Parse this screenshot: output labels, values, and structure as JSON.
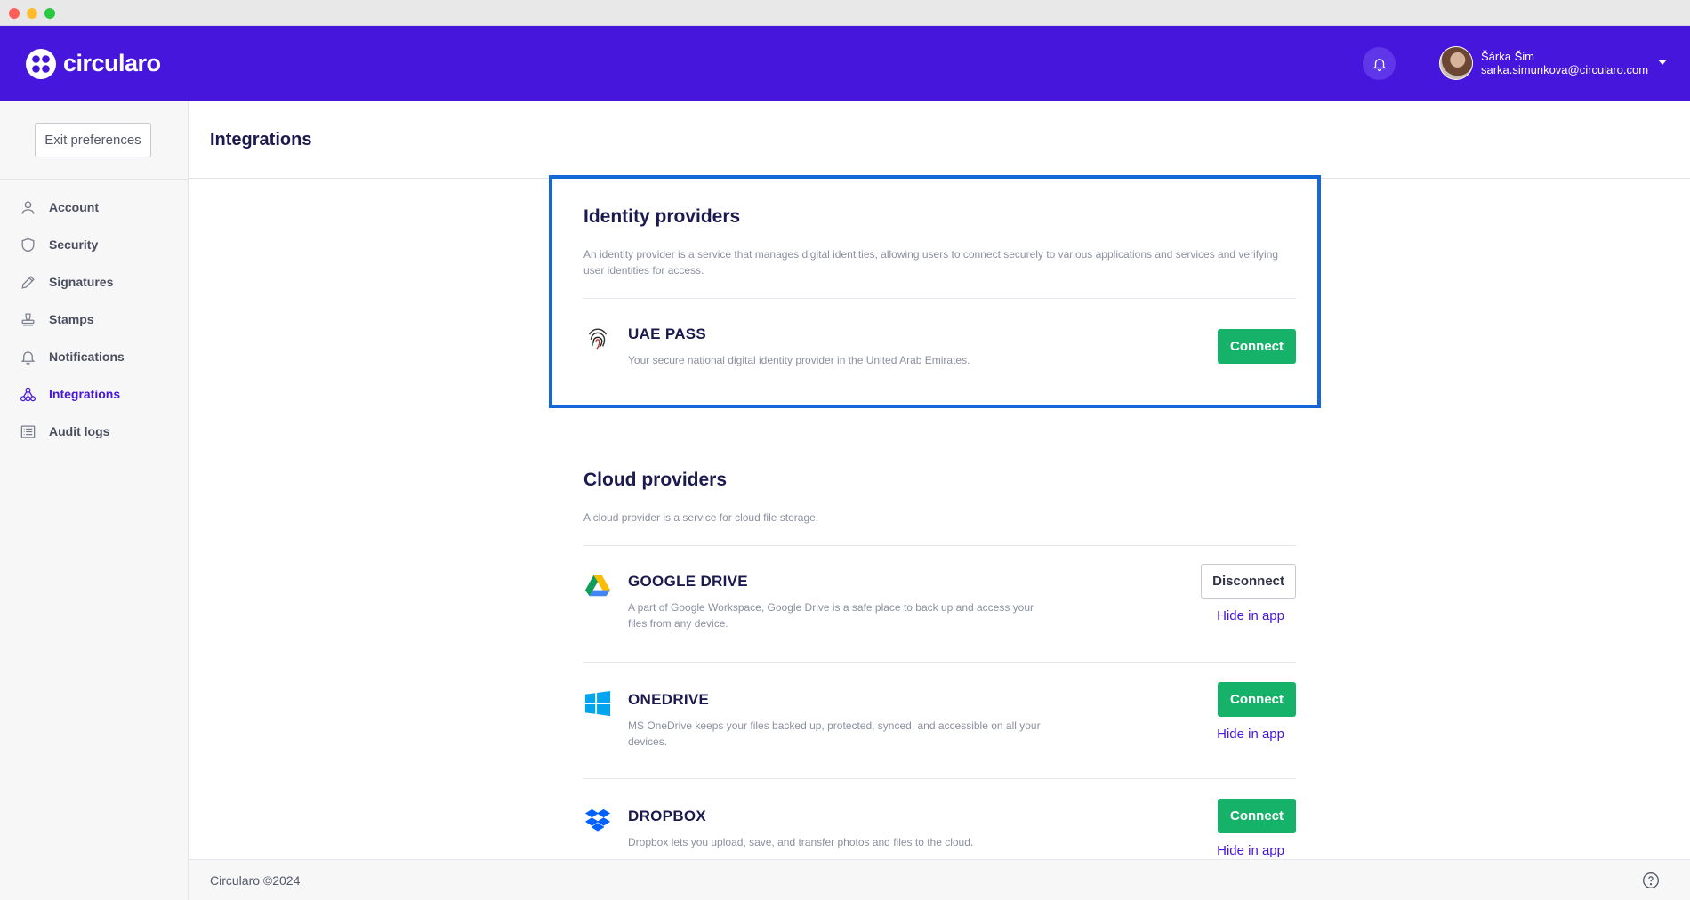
{
  "app": {
    "brand": "circularo",
    "brand_color": "#4716dc",
    "success_color": "#17b26a"
  },
  "header": {
    "user_name": "Šárka Šim",
    "user_email": "sarka.simunkova@circularo.com"
  },
  "sidebar": {
    "exit_label": "Exit preferences",
    "items": [
      {
        "label": "Account",
        "icon": "user-icon",
        "active": false
      },
      {
        "label": "Security",
        "icon": "shield-icon",
        "active": false
      },
      {
        "label": "Signatures",
        "icon": "pen-icon",
        "active": false
      },
      {
        "label": "Stamps",
        "icon": "stamp-icon",
        "active": false
      },
      {
        "label": "Notifications",
        "icon": "bell-icon",
        "active": false
      },
      {
        "label": "Integrations",
        "icon": "integrations-icon",
        "active": true
      },
      {
        "label": "Audit logs",
        "icon": "list-icon",
        "active": false
      }
    ]
  },
  "page": {
    "title": "Integrations"
  },
  "identity": {
    "title": "Identity providers",
    "description": "An identity provider is a service that manages digital identities, allowing users to connect securely to various applications and services and verifying user identities for access.",
    "providers": [
      {
        "name": "UAE PASS",
        "icon": "fingerprint-icon",
        "description": "Your secure national digital identity provider in the United Arab Emirates.",
        "button": "Connect"
      }
    ]
  },
  "cloud": {
    "title": "Cloud providers",
    "description": "A cloud provider is a service for cloud file storage.",
    "providers": [
      {
        "name": "GOOGLE DRIVE",
        "icon": "google-drive-icon",
        "description": "A part of Google Workspace, Google Drive is a safe place to back up and access your files from any device.",
        "button": "Disconnect",
        "link": "Hide in app"
      },
      {
        "name": "ONEDRIVE",
        "icon": "windows-icon",
        "description": "MS OneDrive keeps your files backed up, protected, synced, and accessible on all your devices.",
        "button": "Connect",
        "link": "Hide in app"
      },
      {
        "name": "DROPBOX",
        "icon": "dropbox-icon",
        "description": "Dropbox lets you upload, save, and transfer photos and files to the cloud.",
        "button": "Connect",
        "link": "Hide in app"
      }
    ]
  },
  "footer": {
    "copyright": "Circularo ©2024"
  }
}
